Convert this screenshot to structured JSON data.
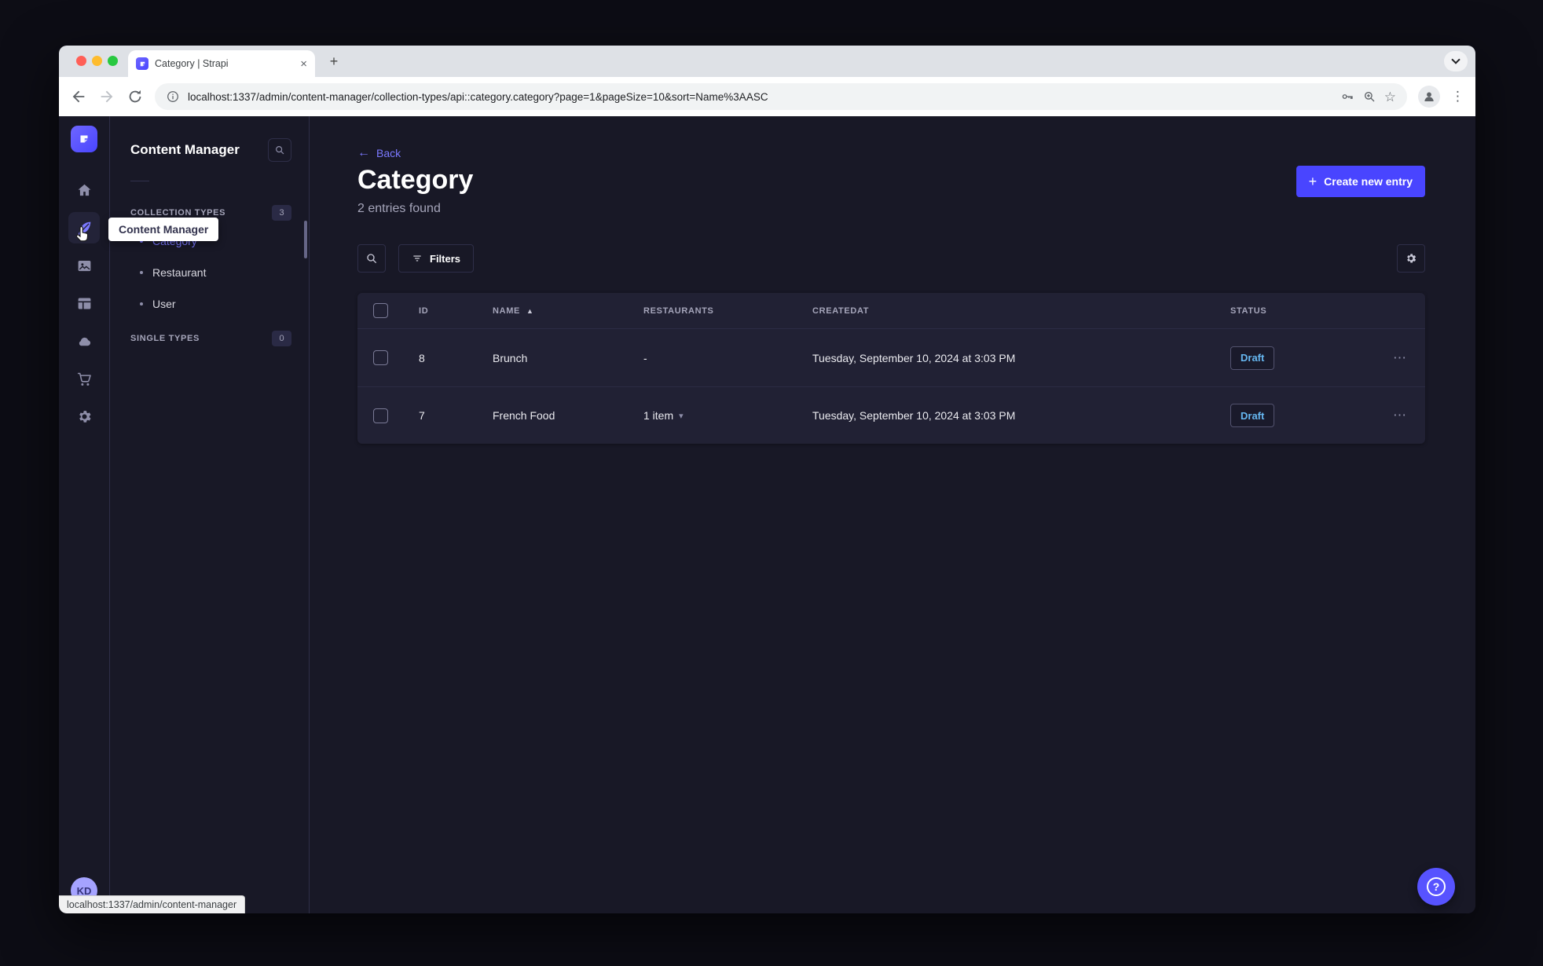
{
  "colors": {
    "primary": "#4945ff",
    "primary_light": "#7b79ff",
    "bg": "#181826",
    "card": "#212134",
    "border": "#2e2e48",
    "text": "#ffffff",
    "muted": "#a5a5ba",
    "draft": "#66b7f1"
  },
  "browser": {
    "tab_title": "Category | Strapi",
    "url": "localhost:1337/admin/content-manager/collection-types/api::category.category?page=1&pageSize=10&sort=Name%3AASC"
  },
  "tooltip": {
    "content_manager": "Content Manager"
  },
  "subnav": {
    "title": "Content Manager",
    "collection_types": {
      "label": "COLLECTION TYPES",
      "count": "3",
      "items": [
        {
          "label": "Category",
          "active": true
        },
        {
          "label": "Restaurant",
          "active": false
        },
        {
          "label": "User",
          "active": false
        }
      ]
    },
    "single_types": {
      "label": "SINGLE TYPES",
      "count": "0"
    }
  },
  "header": {
    "back": "Back",
    "title": "Category",
    "subtitle": "2 entries found",
    "create_button": "Create new entry"
  },
  "toolbar": {
    "filters_button": "Filters"
  },
  "table": {
    "headers": {
      "id": "ID",
      "name": "NAME",
      "restaurants": "RESTAURANTS",
      "createdat": "CREATEDAT",
      "status": "STATUS"
    },
    "rows": [
      {
        "id": "8",
        "name": "Brunch",
        "restaurants": "-",
        "createdat": "Tuesday, September 10, 2024 at 3:03 PM",
        "status": "Draft"
      },
      {
        "id": "7",
        "name": "French Food",
        "restaurants": "1 item",
        "createdat": "Tuesday, September 10, 2024 at 3:03 PM",
        "status": "Draft"
      }
    ]
  },
  "statusbar": {
    "link_preview": "localhost:1337/admin/content-manager"
  },
  "avatar": {
    "initials": "KD"
  },
  "glyphs": {
    "back_arrow": "←",
    "sort_asc": "▲",
    "caret_down": "▾",
    "more": "⋯",
    "star": "☆",
    "menu_dots": "⋮",
    "plus": "+",
    "close": "×",
    "question": "?"
  }
}
